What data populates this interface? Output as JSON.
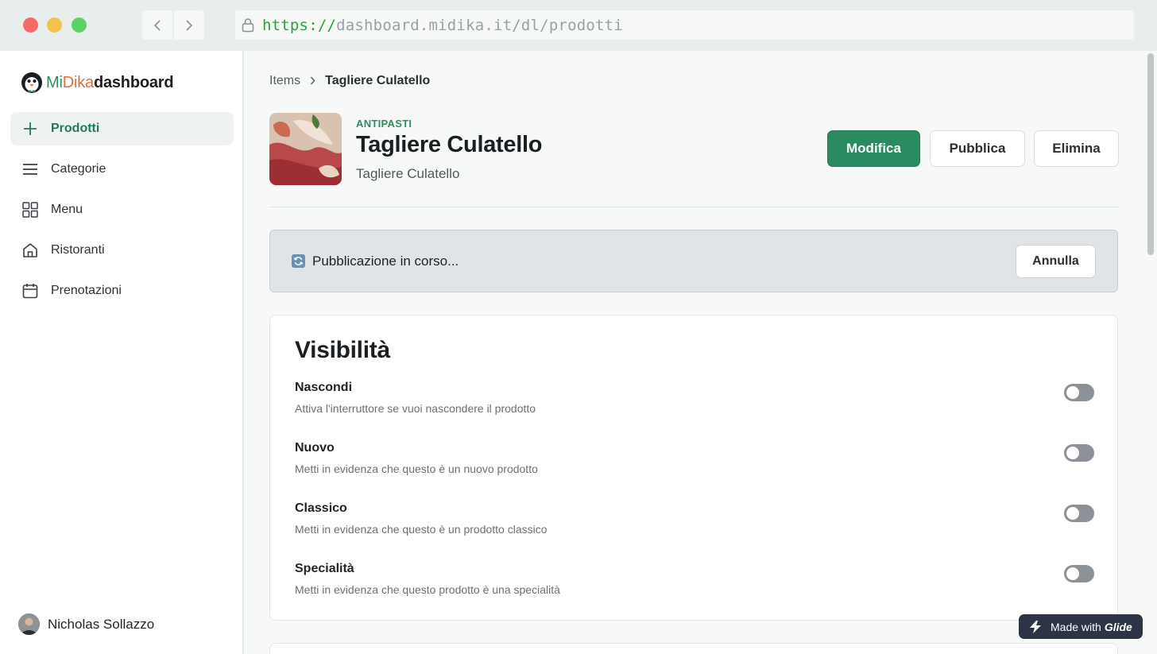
{
  "browser": {
    "url_protocol": "https://",
    "url_rest": "dashboard.midika.it/dl/prodotti"
  },
  "sidebar": {
    "logo": {
      "mi": "Mi",
      "dika": "Dika",
      "dashboard": "dashboard"
    },
    "items": [
      {
        "label": "Prodotti",
        "icon": "plus-icon",
        "active": true
      },
      {
        "label": "Categorie",
        "icon": "list-icon",
        "active": false
      },
      {
        "label": "Menu",
        "icon": "grid-icon",
        "active": false
      },
      {
        "label": "Ristoranti",
        "icon": "home-icon",
        "active": false
      },
      {
        "label": "Prenotazioni",
        "icon": "calendar-icon",
        "active": false
      }
    ],
    "user_name": "Nicholas Sollazzo"
  },
  "breadcrumb": {
    "parent": "Items",
    "current": "Tagliere Culatello"
  },
  "product": {
    "category": "ANTIPASTI",
    "title": "Tagliere Culatello",
    "subtitle": "Tagliere Culatello"
  },
  "actions": {
    "edit": "Modifica",
    "publish": "Pubblica",
    "delete": "Elimina"
  },
  "banner": {
    "text": "Pubblicazione in corso...",
    "cancel": "Annulla"
  },
  "visibility": {
    "heading": "Visibilità",
    "rows": [
      {
        "label": "Nascondi",
        "desc": "Attiva l'interruttore se vuoi nascondere il prodotto",
        "on": false
      },
      {
        "label": "Nuovo",
        "desc": "Metti in evidenza che questo è un nuovo prodotto",
        "on": false
      },
      {
        "label": "Classico",
        "desc": "Metti in evidenza che questo è un prodotto classico",
        "on": false
      },
      {
        "label": "Specialità",
        "desc": "Metti in evidenza che questo prodotto è una specialità",
        "on": false
      }
    ]
  },
  "badge": {
    "prefix": "Made with",
    "brand": "Glide"
  },
  "colors": {
    "accent": "#2a8a60",
    "toggle_off": "#8b9197",
    "badge_bg": "#2c3446"
  }
}
